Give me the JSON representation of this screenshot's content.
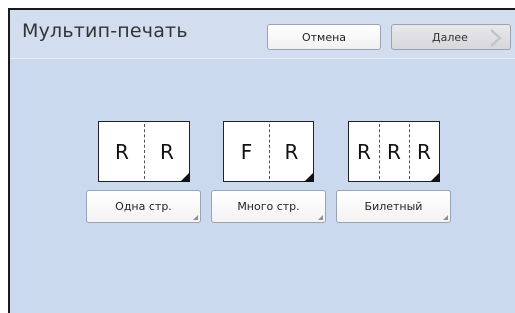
{
  "header": {
    "title": "Мультип-печать",
    "cancel_label": "Отмена",
    "next_label": "Далее"
  },
  "layouts": [
    {
      "columns": [
        "R",
        "R"
      ],
      "button_label": "Одна стр."
    },
    {
      "columns": [
        "F",
        "R"
      ],
      "button_label": "Много стр."
    },
    {
      "columns": [
        "R",
        "R",
        "R"
      ],
      "button_label": "Билетный"
    }
  ],
  "colors": {
    "panel": "#cbd9ef",
    "header": "#d2deef",
    "next_button_disabled": "#dcdce0"
  },
  "icons": {
    "next": "chevron-right-icon",
    "sheet_corner": "dog-ear-corner"
  }
}
